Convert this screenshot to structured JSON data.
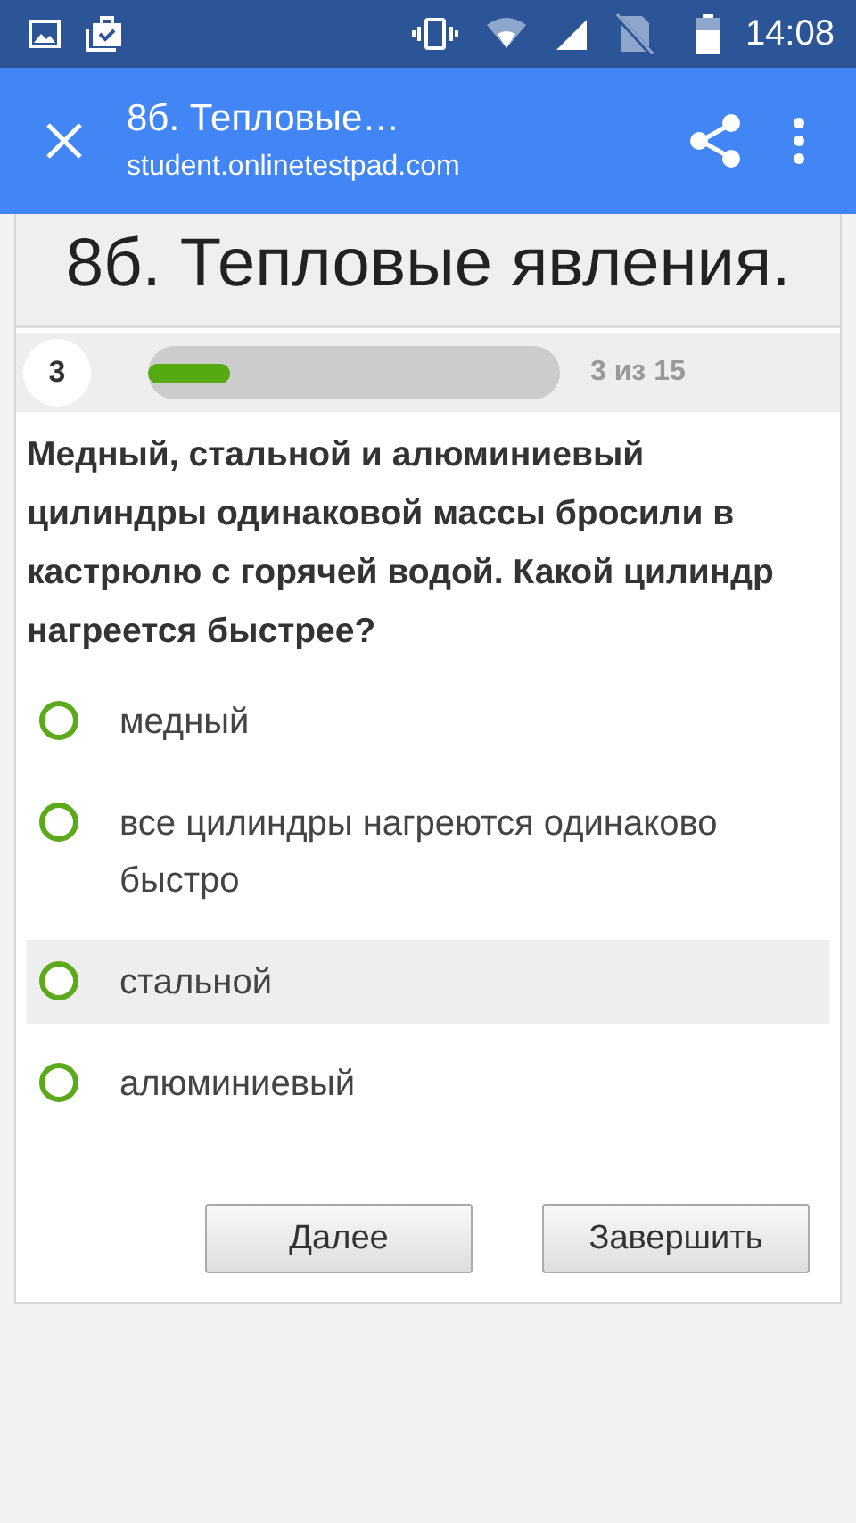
{
  "status_bar": {
    "time": "14:08"
  },
  "toolbar": {
    "title": "8б. Тепловые…",
    "url": "student.onlinetestpad.com"
  },
  "test_title": "8б. Тепловые явления.",
  "progress": {
    "number": "3",
    "level": 0.2,
    "counter": "3 из 15"
  },
  "question": "Медный, стальной и алюминиевый цилиндры одинаковой массы бросили в кастрюлю с горячей водой. Какой цилиндр нагреется быстрее?",
  "options": [
    {
      "label": "медный",
      "selected": false,
      "highlighted": false
    },
    {
      "label": "все цилиндры нагреются одинаково быстро",
      "selected": false,
      "highlighted": false
    },
    {
      "label": "стальной",
      "selected": false,
      "highlighted": true
    },
    {
      "label": "алюминиевый",
      "selected": false,
      "highlighted": false
    }
  ],
  "buttons": [
    "Далее",
    "Завершить"
  ]
}
